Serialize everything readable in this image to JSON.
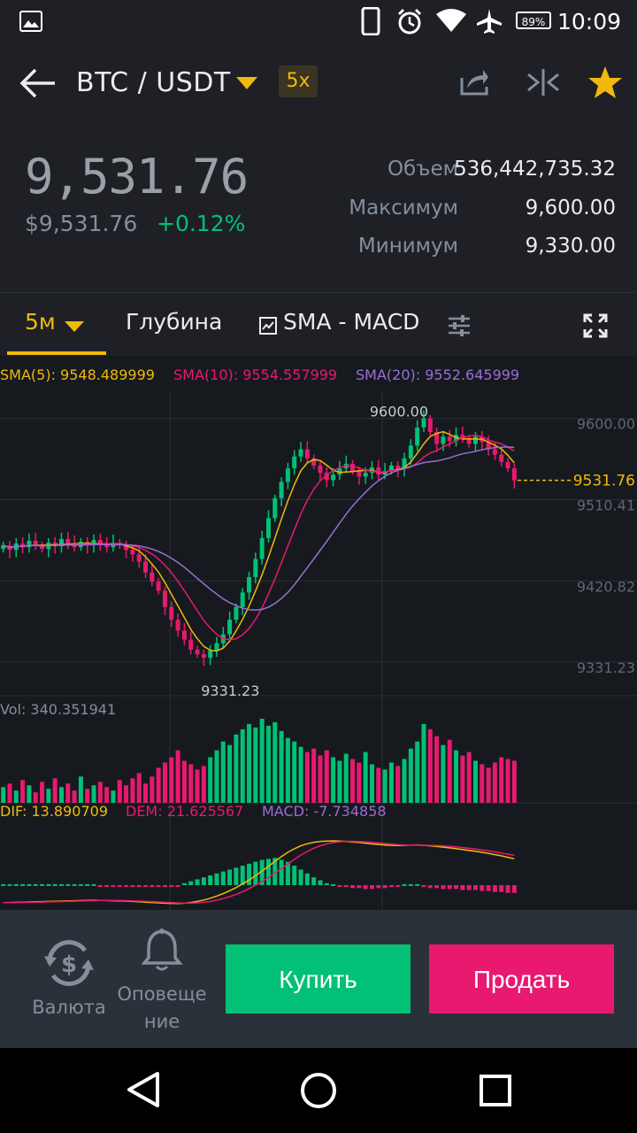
{
  "status_bar": {
    "time": "10:09",
    "battery": "89%"
  },
  "header": {
    "pair": "BTC / USDT",
    "leverage": "5x"
  },
  "ticker": {
    "last_price": "9,531.76",
    "usd_price": "$9,531.76",
    "change": "+0.12%",
    "volume_label": "Объем",
    "volume_value": "536,442,735.32",
    "high_label": "Максимум",
    "high_value": "9,600.00",
    "low_label": "Минимум",
    "low_value": "9,330.00"
  },
  "tabs": {
    "interval": "5м",
    "depth": "Глубина",
    "indicators": "SMA - MACD"
  },
  "chart_data": {
    "type": "candlestick",
    "sma_legend": [
      {
        "label": "SMA(5): 9548.489999",
        "color": "#f0b90b"
      },
      {
        "label": "SMA(10): 9554.557999",
        "color": "#e8196f"
      },
      {
        "label": "SMA(20): 9552.645999",
        "color": "#9b6dd6"
      }
    ],
    "y_ticks": [
      "9600.00",
      "9510.41",
      "9420.82",
      "9331.23"
    ],
    "current_price_label": "9531.76",
    "max_marker": "9600.00",
    "min_marker": "9331.23",
    "volume_label": "Vol: 340.351941",
    "macd_legend": [
      {
        "label": "DIF: 13.890709",
        "color": "#f0b90b"
      },
      {
        "label": "DEM: 21.625567",
        "color": "#e8196f"
      },
      {
        "label": "MACD: -7.734858",
        "color": "#9b6dd6"
      }
    ],
    "ylim": [
      9300,
      9630
    ],
    "closes": [
      9460,
      9455,
      9462,
      9458,
      9465,
      9460,
      9456,
      9463,
      9459,
      9467,
      9462,
      9458,
      9464,
      9460,
      9466,
      9461,
      9458,
      9463,
      9460,
      9455,
      9450,
      9442,
      9430,
      9420,
      9410,
      9392,
      9378,
      9366,
      9356,
      9345,
      9340,
      9336,
      9344,
      9352,
      9362,
      9378,
      9392,
      9408,
      9425,
      9445,
      9468,
      9490,
      9512,
      9530,
      9545,
      9558,
      9566,
      9556,
      9548,
      9540,
      9532,
      9538,
      9545,
      9550,
      9542,
      9536,
      9540,
      9546,
      9538,
      9542,
      9548,
      9544,
      9556,
      9570,
      9590,
      9600,
      9585,
      9572,
      9580,
      9575,
      9582,
      9578,
      9572,
      9580,
      9574,
      9566,
      9560,
      9552,
      9545,
      9531.76
    ],
    "volumes": [
      18,
      22,
      14,
      26,
      20,
      12,
      24,
      16,
      28,
      18,
      22,
      14,
      30,
      16,
      20,
      24,
      18,
      14,
      26,
      20,
      28,
      34,
      22,
      30,
      40,
      46,
      52,
      60,
      48,
      44,
      38,
      42,
      52,
      60,
      70,
      66,
      78,
      84,
      90,
      86,
      96,
      88,
      92,
      82,
      74,
      70,
      64,
      58,
      62,
      54,
      60,
      52,
      48,
      56,
      50,
      46,
      58,
      44,
      40,
      38,
      46,
      42,
      50,
      62,
      70,
      90,
      84,
      76,
      66,
      72,
      60,
      54,
      58,
      48,
      44,
      40,
      46,
      52,
      50,
      48
    ],
    "macd_hist": [
      1,
      1,
      1,
      1,
      1,
      1,
      1,
      1,
      1,
      1,
      1,
      1,
      1,
      1,
      1,
      -1,
      -1,
      -1,
      -1,
      -1,
      -2,
      -2,
      -2,
      -2,
      -2,
      -2,
      -1,
      -1,
      2,
      4,
      6,
      8,
      10,
      12,
      14,
      16,
      18,
      20,
      22,
      24,
      26,
      27,
      28,
      26,
      24,
      20,
      16,
      12,
      8,
      5,
      2,
      1,
      -1,
      -2,
      -3,
      -3,
      -4,
      -4,
      -3,
      -3,
      -2,
      -1,
      1,
      1,
      1,
      -2,
      -3,
      -3,
      -4,
      -4,
      -4,
      -5,
      -5,
      -5,
      -6,
      -6,
      -7,
      -7,
      -8,
      -8
    ]
  },
  "actions": {
    "currency_label": "Валюта",
    "alert_label_line1": "Оповеще",
    "alert_label_line2": "ние",
    "buy_label": "Купить",
    "sell_label": "Продать"
  },
  "colors": {
    "accent": "#f0b90b",
    "up": "#02c076",
    "down": "#e8196f",
    "bg": "#1e2026",
    "chart_bg": "#161a1e"
  }
}
